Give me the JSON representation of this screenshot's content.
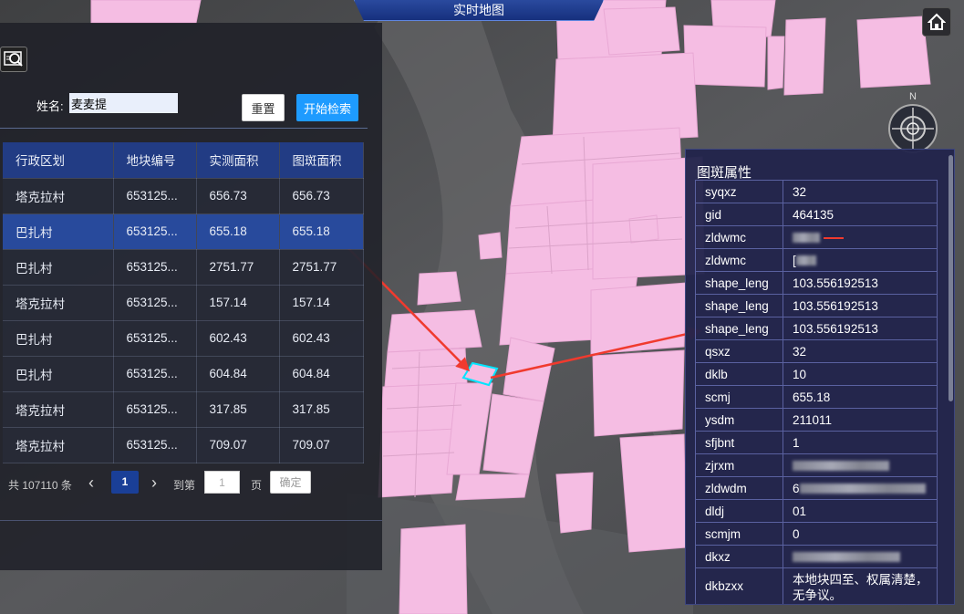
{
  "header": {
    "title": "实时地图"
  },
  "search": {
    "name_label": "姓名:",
    "name_value": "麦麦提",
    "reset_label": "重置",
    "search_label": "开始检索"
  },
  "table": {
    "columns": [
      "行政区划",
      "地块编号",
      "实测面积",
      "图斑面积"
    ],
    "rows": [
      [
        "塔克拉村",
        "653125...",
        "656.73",
        "656.73"
      ],
      [
        "巴扎村",
        "653125...",
        "655.18",
        "655.18"
      ],
      [
        "巴扎村",
        "653125...",
        "2751.77",
        "2751.77"
      ],
      [
        "塔克拉村",
        "653125...",
        "157.14",
        "157.14"
      ],
      [
        "巴扎村",
        "653125...",
        "602.43",
        "602.43"
      ],
      [
        "巴扎村",
        "653125...",
        "604.84",
        "604.84"
      ],
      [
        "塔克拉村",
        "653125...",
        "317.85",
        "317.85"
      ],
      [
        "塔克拉村",
        "653125...",
        "709.07",
        "709.07"
      ]
    ],
    "selected_row": 1
  },
  "pagination": {
    "total": "共 107110 条",
    "current_page": "1",
    "goto_label": "到第",
    "goto_value": "1",
    "page_label": "页",
    "confirm_label": "确定"
  },
  "attributes": {
    "title": "图斑属性",
    "rows": [
      {
        "key": "syqxz",
        "value": "32"
      },
      {
        "key": "gid",
        "value": "464135"
      },
      {
        "key": "zldwmc",
        "value": ""
      },
      {
        "key": "zldwmc",
        "value": "["
      },
      {
        "key": "shape_leng",
        "value": "103.556192513"
      },
      {
        "key": "shape_leng",
        "value": "103.556192513"
      },
      {
        "key": "shape_leng",
        "value": "103.556192513"
      },
      {
        "key": "qsxz",
        "value": "32"
      },
      {
        "key": "dklb",
        "value": "10"
      },
      {
        "key": "scmj",
        "value": "655.18"
      },
      {
        "key": "ysdm",
        "value": "211011"
      },
      {
        "key": "sfjbnt",
        "value": "1"
      },
      {
        "key": "zjrxm",
        "value": ""
      },
      {
        "key": "zldwdm",
        "value": "6"
      },
      {
        "key": "dldj",
        "value": "01"
      },
      {
        "key": "scmjm",
        "value": "0"
      },
      {
        "key": "dkxz",
        "value": ""
      },
      {
        "key": "dkbzxx",
        "value": "本地块四至、权属清楚，无争议。"
      }
    ]
  },
  "map": {
    "compass_label": "N",
    "parcel_color": "#f5bde3",
    "highlight_color": "#00e5ff",
    "annotation_color": "#f03a2e"
  },
  "icons": {
    "home": "home-icon",
    "search_panel": "map-search-icon",
    "compass": "compass-icon"
  }
}
